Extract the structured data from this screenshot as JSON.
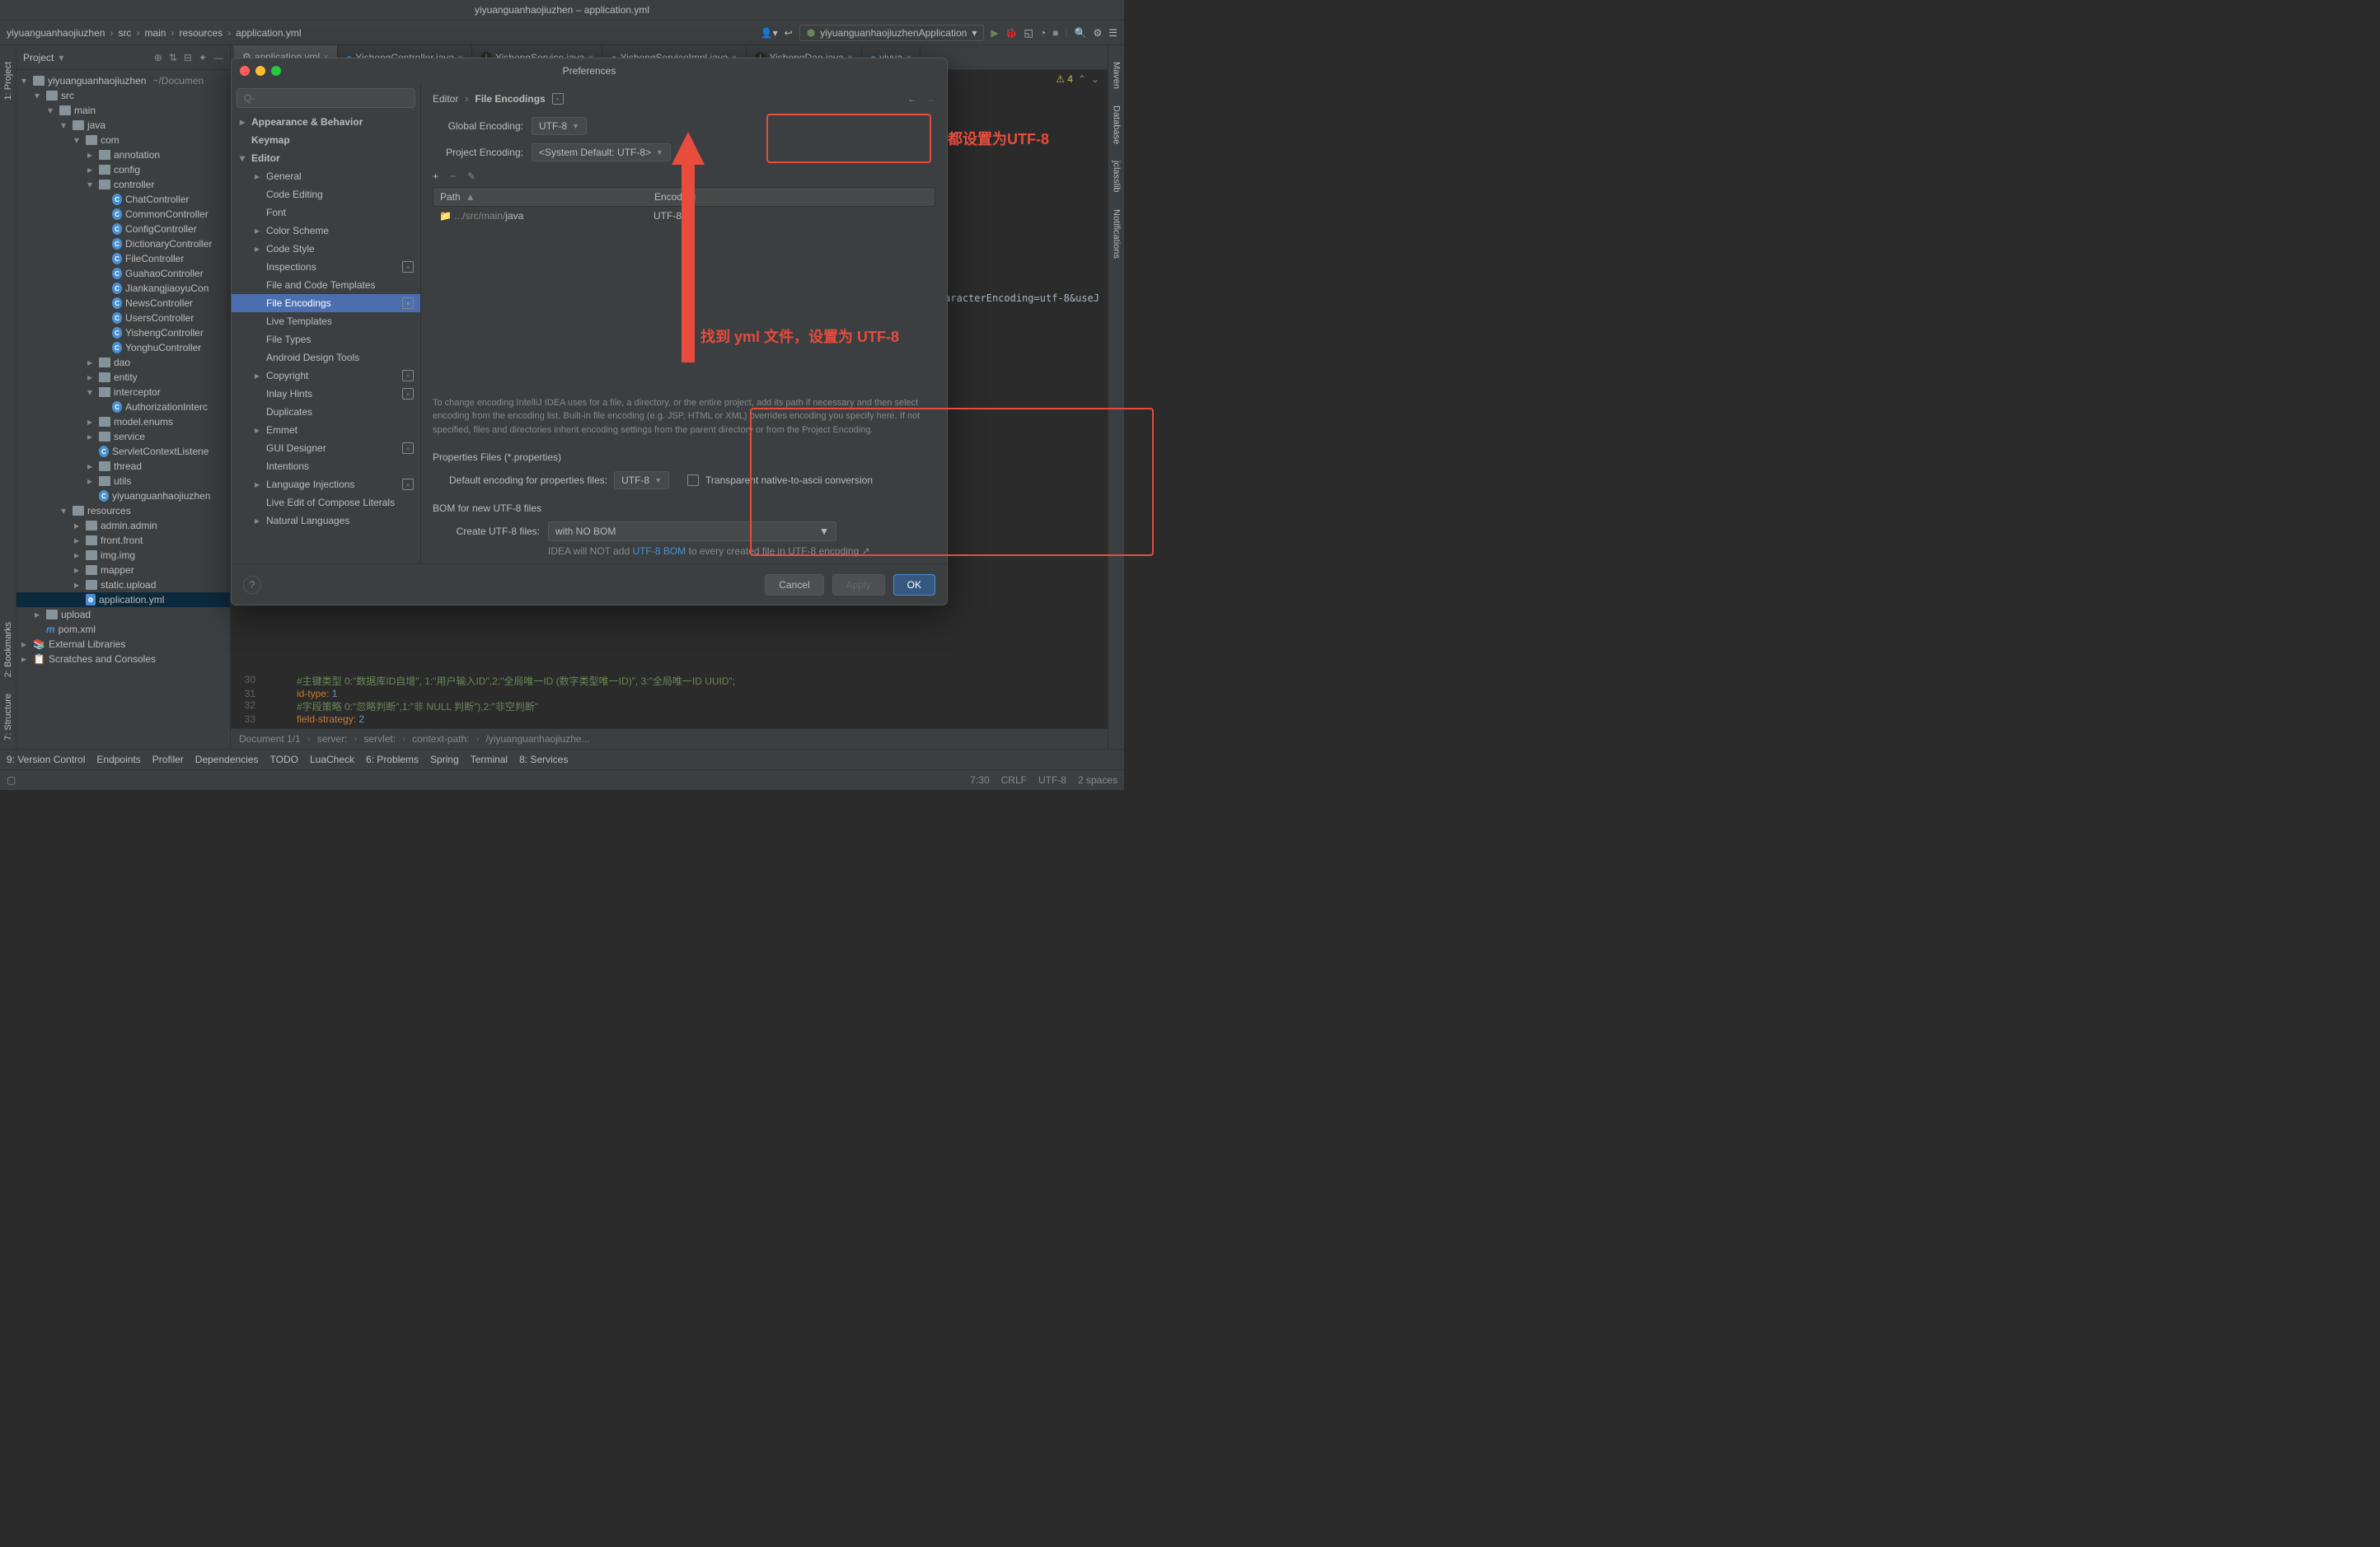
{
  "window": {
    "title": "yiyuanguanhaojiuzhen – application.yml"
  },
  "breadcrumbs": [
    "yiyuanguanhaojiuzhen",
    "src",
    "main",
    "resources",
    "application.yml"
  ],
  "run_config": "yiyuanguanhaojiuzhenApplication",
  "project_panel": {
    "title": "Project"
  },
  "tree": [
    {
      "l": 0,
      "t": "▾",
      "icon": "folder",
      "name": "yiyuanguanhaojiuzhen",
      "suffix": "~/Documen"
    },
    {
      "l": 1,
      "t": "▾",
      "icon": "folder",
      "name": "src"
    },
    {
      "l": 2,
      "t": "▾",
      "icon": "folder",
      "name": "main"
    },
    {
      "l": 3,
      "t": "▾",
      "icon": "folder",
      "name": "java",
      "cls": "blue"
    },
    {
      "l": 4,
      "t": "▾",
      "icon": "pkg",
      "name": "com"
    },
    {
      "l": 5,
      "t": "▸",
      "icon": "pkg",
      "name": "annotation"
    },
    {
      "l": 5,
      "t": "▸",
      "icon": "pkg",
      "name": "config"
    },
    {
      "l": 5,
      "t": "▾",
      "icon": "pkg",
      "name": "controller"
    },
    {
      "l": 6,
      "icon": "class",
      "name": "ChatController"
    },
    {
      "l": 6,
      "icon": "class",
      "name": "CommonController"
    },
    {
      "l": 6,
      "icon": "class",
      "name": "ConfigController"
    },
    {
      "l": 6,
      "icon": "class",
      "name": "DictionaryController"
    },
    {
      "l": 6,
      "icon": "class",
      "name": "FileController"
    },
    {
      "l": 6,
      "icon": "class",
      "name": "GuahaoController"
    },
    {
      "l": 6,
      "icon": "class",
      "name": "JiankangjiaoyuCon"
    },
    {
      "l": 6,
      "icon": "class",
      "name": "NewsController"
    },
    {
      "l": 6,
      "icon": "class",
      "name": "UsersController"
    },
    {
      "l": 6,
      "icon": "class",
      "name": "YishengController"
    },
    {
      "l": 6,
      "icon": "class",
      "name": "YonghuController"
    },
    {
      "l": 5,
      "t": "▸",
      "icon": "pkg",
      "name": "dao"
    },
    {
      "l": 5,
      "t": "▸",
      "icon": "pkg",
      "name": "entity"
    },
    {
      "l": 5,
      "t": "▾",
      "icon": "pkg",
      "name": "interceptor"
    },
    {
      "l": 6,
      "icon": "class",
      "name": "AuthorizationInterc"
    },
    {
      "l": 5,
      "t": "▸",
      "icon": "pkg",
      "name": "model.enums"
    },
    {
      "l": 5,
      "t": "▸",
      "icon": "pkg",
      "name": "service"
    },
    {
      "l": 5,
      "icon": "class",
      "name": "ServletContextListene"
    },
    {
      "l": 5,
      "t": "▸",
      "icon": "pkg",
      "name": "thread"
    },
    {
      "l": 5,
      "t": "▸",
      "icon": "pkg",
      "name": "utils"
    },
    {
      "l": 5,
      "icon": "class",
      "name": "yiyuanguanhaojiuzhen"
    },
    {
      "l": 3,
      "t": "▾",
      "icon": "folder",
      "name": "resources",
      "cls": "res"
    },
    {
      "l": 4,
      "t": "▸",
      "icon": "pkg",
      "name": "admin.admin"
    },
    {
      "l": 4,
      "t": "▸",
      "icon": "pkg",
      "name": "front.front"
    },
    {
      "l": 4,
      "t": "▸",
      "icon": "pkg",
      "name": "img.img"
    },
    {
      "l": 4,
      "t": "▸",
      "icon": "pkg",
      "name": "mapper"
    },
    {
      "l": 4,
      "t": "▸",
      "icon": "pkg",
      "name": "static.upload"
    },
    {
      "l": 4,
      "icon": "yml",
      "name": "application.yml",
      "sel": true
    },
    {
      "l": 1,
      "t": "▸",
      "icon": "folder",
      "name": "upload"
    },
    {
      "l": 1,
      "icon": "mvn",
      "name": "pom.xml"
    },
    {
      "l": 0,
      "t": "▸",
      "icon": "lib",
      "name": "External Libraries"
    },
    {
      "l": 0,
      "t": "▸",
      "icon": "scratch",
      "name": "Scratches and Consoles"
    }
  ],
  "tabs": [
    {
      "name": "application.yml",
      "icon": "yml",
      "active": true
    },
    {
      "name": "YishengController.java",
      "icon": "class"
    },
    {
      "name": "YishengService.java",
      "icon": "iface"
    },
    {
      "name": "YishengServiceImpl.java",
      "icon": "class"
    },
    {
      "name": "YishengDao.java",
      "icon": "iface"
    },
    {
      "name": "yiyua",
      "icon": "class"
    }
  ],
  "code": {
    "visible_right": "&characterEncoding=utf-8&useJ",
    "lines": [
      {
        "n": 30,
        "text": "#主键类型  0:\"数据库ID自增\", 1:\"用户输入ID\",2:\"全局唯一ID (数字类型唯一ID)\", 3:\"全局唯一ID UUID\";",
        "cls": "str"
      },
      {
        "n": 31,
        "text": "id-type: 1",
        "cls": "kv"
      },
      {
        "n": 32,
        "text": "#字段策略 0:\"忽略判断\",1:\"非 NULL 判断\"),2:\"非空判断\"",
        "cls": "str"
      },
      {
        "n": 33,
        "text": "field-strategy: 2",
        "cls": "kv"
      }
    ]
  },
  "editor_breadcrumb": [
    "Document 1/1",
    "server:",
    "servlet:",
    "context-path:",
    "/yiyuanguanhaojiuzhe..."
  ],
  "bottom_tools": [
    "9: Version Control",
    "Endpoints",
    "Profiler",
    "Dependencies",
    "TODO",
    "LuaCheck",
    "6: Problems",
    "Spring",
    "Terminal",
    "8: Services"
  ],
  "status": {
    "left": "",
    "right": [
      "7:30",
      "CRLF",
      "UTF-8",
      "2 spaces"
    ]
  },
  "modal": {
    "title": "Preferences",
    "search_placeholder": "Q-",
    "sidebar": [
      {
        "l": 0,
        "t": "▸",
        "name": "Appearance & Behavior"
      },
      {
        "l": 0,
        "name": "Keymap"
      },
      {
        "l": 0,
        "t": "▾",
        "name": "Editor"
      },
      {
        "l": 1,
        "t": "▸",
        "name": "General"
      },
      {
        "l": 1,
        "name": "Code Editing"
      },
      {
        "l": 1,
        "name": "Font"
      },
      {
        "l": 1,
        "t": "▸",
        "name": "Color Scheme"
      },
      {
        "l": 1,
        "t": "▸",
        "name": "Code Style"
      },
      {
        "l": 1,
        "name": "Inspections",
        "badge": true
      },
      {
        "l": 1,
        "name": "File and Code Templates"
      },
      {
        "l": 1,
        "name": "File Encodings",
        "badge": true,
        "selected": true
      },
      {
        "l": 1,
        "name": "Live Templates"
      },
      {
        "l": 1,
        "name": "File Types"
      },
      {
        "l": 1,
        "name": "Android Design Tools"
      },
      {
        "l": 1,
        "t": "▸",
        "name": "Copyright",
        "badge": true
      },
      {
        "l": 1,
        "name": "Inlay Hints",
        "badge": true
      },
      {
        "l": 1,
        "name": "Duplicates"
      },
      {
        "l": 1,
        "t": "▸",
        "name": "Emmet"
      },
      {
        "l": 1,
        "name": "GUI Designer",
        "badge": true
      },
      {
        "l": 1,
        "name": "Intentions"
      },
      {
        "l": 1,
        "t": "▸",
        "name": "Language Injections",
        "badge": true
      },
      {
        "l": 1,
        "name": "Live Edit of Compose Literals"
      },
      {
        "l": 1,
        "t": "▸",
        "name": "Natural Languages"
      }
    ],
    "content": {
      "breadcrumb": [
        "Editor",
        "File Encodings"
      ],
      "global_encoding_label": "Global Encoding:",
      "global_encoding_value": "UTF-8",
      "project_encoding_label": "Project Encoding:",
      "project_encoding_value": "<System Default: UTF-8>",
      "path_header": "Path",
      "encoding_header": "Encoding",
      "path_row": ".../src/main/java",
      "encoding_row": "UTF-8",
      "help_text": "To change encoding IntelliJ IDEA uses for a file, a directory, or the entire project, add its path if necessary and then select encoding from the encoding list. Built-in file encoding (e.g. JSP, HTML or XML) overrides encoding you specify here. If not specified, files and directories inherit encoding settings from the parent directory or from the Project Encoding.",
      "props_section": "Properties Files (*.properties)",
      "props_label": "Default encoding for properties files:",
      "props_value": "UTF-8",
      "transparent_label": "Transparent native-to-ascii conversion",
      "bom_section": "BOM for new UTF-8 files",
      "create_label": "Create UTF-8 files:",
      "create_value": "with NO BOM",
      "bom_help_prefix": "IDEA will NOT add ",
      "bom_help_link": "UTF-8 BOM",
      "bom_help_suffix": " to every created file in UTF-8 encoding"
    },
    "footer": {
      "cancel": "Cancel",
      "apply": "Apply",
      "ok": "OK"
    }
  },
  "annotations": {
    "a1": "都设置为UTF-8",
    "a2": "找到 yml 文件，设置为 UTF-8"
  },
  "problems_badge": "4"
}
